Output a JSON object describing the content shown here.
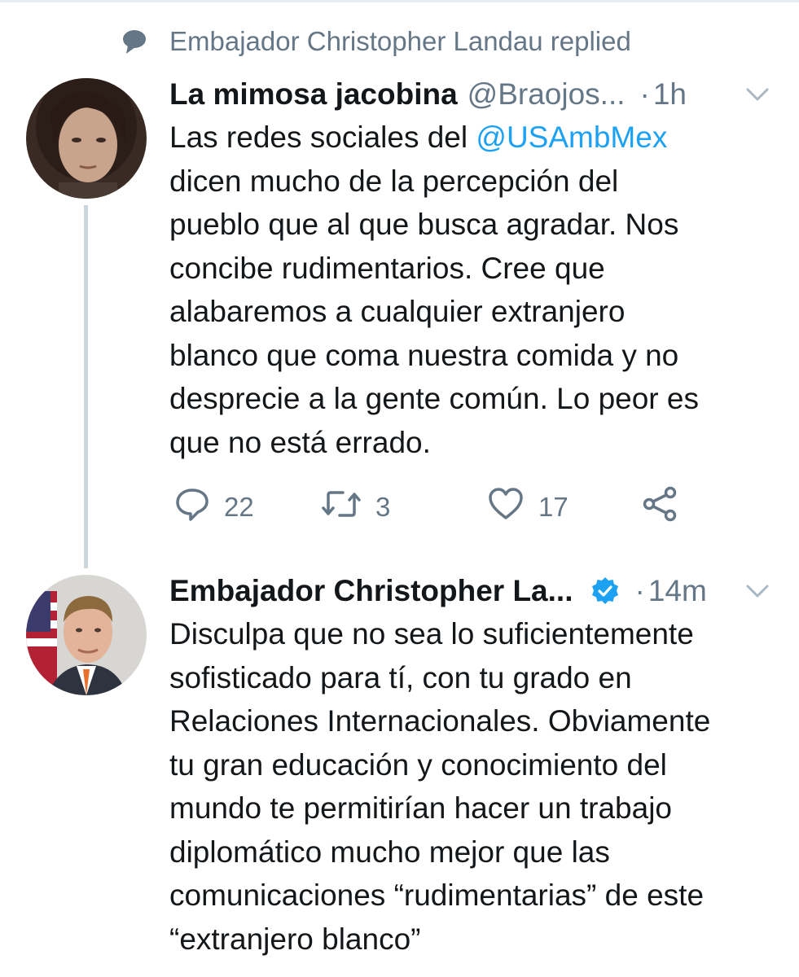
{
  "context": {
    "icon": "speech-bubble-icon",
    "text": "Embajador Christopher Landau replied"
  },
  "tweets": [
    {
      "author_name": "La mimosa jacobina",
      "handle": "@Braojos...",
      "separator": "·",
      "time": "1h",
      "body_before": "Las redes sociales del ",
      "mention": "@USAmbMex",
      "body_after": "\ndicen mucho de la percepción del\npueblo que al que busca agradar. Nos\nconcibe rudimentarios. Cree que\nalabaremos a cualquier extranjero\nblanco que coma nuestra comida y no\ndesprecie a la gente común. Lo peor es\nque no está errado.",
      "actions": {
        "replies": "22",
        "retweets": "3",
        "likes": "17"
      }
    },
    {
      "author_name": "Embajador Christopher La...",
      "verified": true,
      "separator": "·",
      "time": "14m",
      "body": "Disculpa que no sea lo suficientemente\nsofisticado para tí, con tu grado en\nRelaciones Internacionales. Obviamente\ntu gran educación y conocimiento del\nmundo te permitirían hacer un trabajo\ndiplomático mucho mejor que las\ncomunicaciones “rudimentarias” de este\n“extranjero blanco”"
    }
  ],
  "colors": {
    "text": "#14171a",
    "secondary": "#657786",
    "link": "#1da1f2",
    "thread_line": "#ccd6dd"
  }
}
